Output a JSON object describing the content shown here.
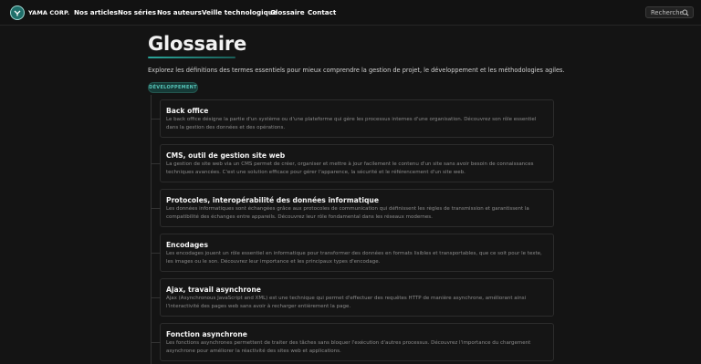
{
  "brand": {
    "name": "YAMA CORP."
  },
  "nav": [
    {
      "label": "Nos articles"
    },
    {
      "label": "Nos séries"
    },
    {
      "label": "Nos auteurs"
    },
    {
      "label": "Veille technologique"
    },
    {
      "label": "Glossaire"
    },
    {
      "label": "Contact"
    }
  ],
  "search": {
    "placeholder": "Recherche",
    "icon": "search-icon"
  },
  "main": {
    "title": "Glossaire",
    "intro": "Explorez les définitions des termes essentiels pour mieux comprendre la gestion de projet, le développement et les méthodologies agiles.",
    "category": "DÉVELOPPEMENT"
  },
  "entries": [
    {
      "title": "Back office",
      "description": "Le back office désigne la partie d'un système ou d'une plateforme qui gère les processus internes d'une organisation. Découvrez son rôle essentiel dans la gestion des données et des opérations."
    },
    {
      "title": "CMS, outil de gestion site web",
      "description": "La gestion de site web via un CMS permet de créer, organiser et mettre à jour facilement le contenu d'un site sans avoir besoin de connaissances techniques avancées. C'est une solution efficace pour gérer l'apparence, la sécurité et le référencement d'un site web."
    },
    {
      "title": "Protocoles, interopérabilité des données informatique",
      "description": "Les données informatiques sont échangées grâce aux protocoles de communication qui définissent les règles de transmission et garantissent la compatibilité des échanges entre appareils. Découvrez leur rôle fondamental dans les réseaux modernes."
    },
    {
      "title": "Encodages",
      "description": "Les encodages jouent un rôle essentiel en informatique pour transformer des données en formats lisibles et transportables, que ce soit pour le texte, les images ou le son. Découvrez leur importance et les principaux types d'encodage."
    },
    {
      "title": "Ajax, travail asynchrone",
      "description": "Ajax (Asynchronous JavaScript and XML) est une technique qui permet d'effectuer des requêtes HTTP de manière asynchrone, améliorant ainsi l'interactivité des pages web sans avoir à recharger entièrement la page."
    },
    {
      "title": "Fonction asynchrone",
      "description": "Les fonctions asynchrones permettent de traiter des tâches sans bloquer l'exécution d'autres processus. Découvrez l'importance du chargement asynchrone pour améliorer la réactivité des sites web et applications."
    }
  ]
}
